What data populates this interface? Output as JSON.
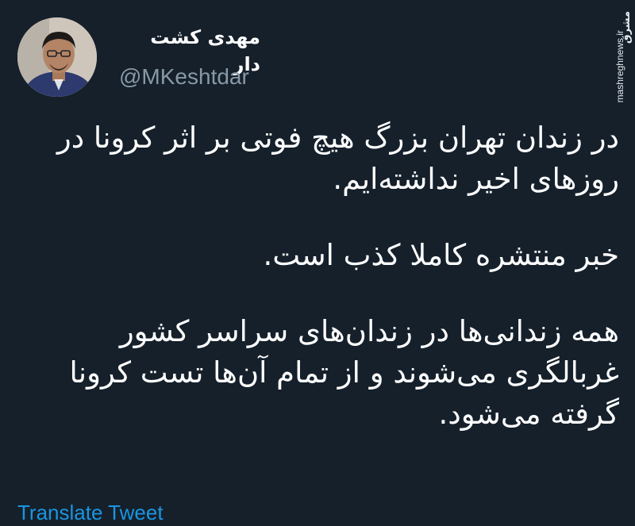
{
  "user": {
    "display_name": "مهدی کشت دار",
    "handle": "@MKeshtdar"
  },
  "watermark": {
    "logo_text": "مشرق",
    "url": "mashreghnews.ir"
  },
  "tweet": {
    "paragraphs": [
      [
        "در زندان تهران بزرگ هیچ فوتی بر اثر کرونا در",
        "روزهای اخیر نداشته‌ایم."
      ],
      [
        "خبر منتشره کاملا کذب است."
      ],
      [
        "همه زندانی‌ها در زندان‌های سراسر کشور",
        "غربالگری می‌شوند و از تمام آن‌ها تست کرونا",
        "گرفته می‌شود."
      ]
    ]
  },
  "actions": {
    "translate_label": "Translate Tweet"
  },
  "colors": {
    "background": "#15202b",
    "text": "#ffffff",
    "secondary": "#8899a6",
    "link": "#1b95e0"
  }
}
